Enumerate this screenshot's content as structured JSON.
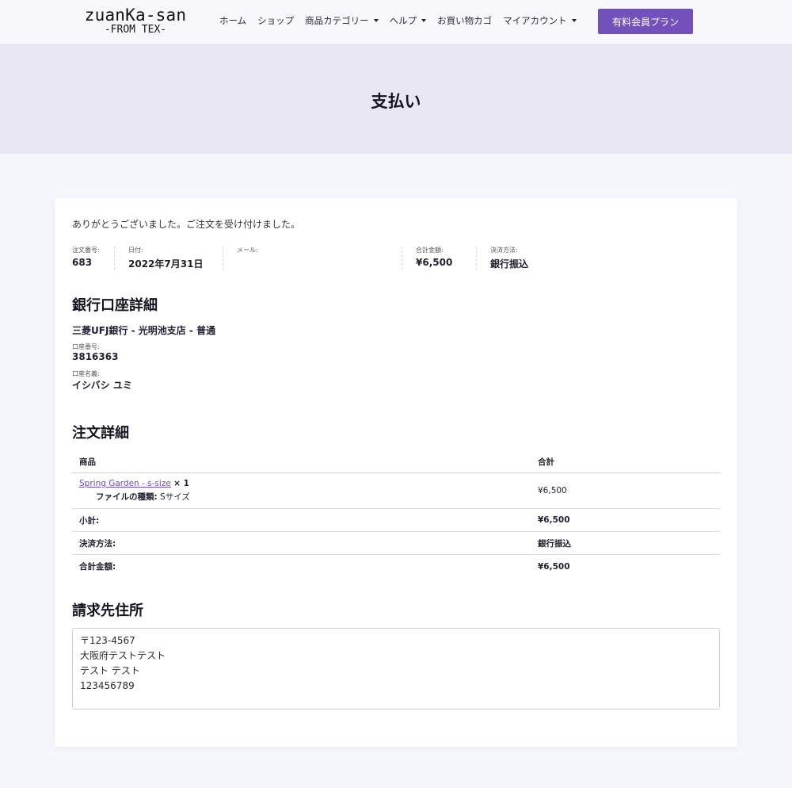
{
  "header": {
    "logo_main": "zuanKa-san",
    "logo_sub": "-FROM TEX-",
    "nav": [
      {
        "label": "ホーム",
        "dropdown": false
      },
      {
        "label": "ショップ",
        "dropdown": false
      },
      {
        "label": "商品カテゴリー",
        "dropdown": true
      },
      {
        "label": "ヘルプ",
        "dropdown": true
      },
      {
        "label": "お買い物カゴ",
        "dropdown": false
      },
      {
        "label": "マイアカウント",
        "dropdown": true
      }
    ],
    "cta_label": "有料会員プラン",
    "cta_color": "#7251bd"
  },
  "hero": {
    "title": "支払い"
  },
  "order": {
    "thanks": "ありがとうございました。ご注文を受け付けました。",
    "overview": [
      {
        "label": "注文番号:",
        "value": "683"
      },
      {
        "label": "日付:",
        "value": "2022年7月31日"
      },
      {
        "label": "メール:",
        "value": ""
      },
      {
        "label": "合計金額:",
        "value": "¥6,500"
      },
      {
        "label": "決済方法:",
        "value": "銀行振込"
      }
    ]
  },
  "bank": {
    "heading": "銀行口座詳細",
    "bank_name": "三菱UFJ銀行 - 光明池支店 - 普通",
    "account_number_label": "口座番号:",
    "account_number": "3816363",
    "account_name_label": "口座名義:",
    "account_name": "イシバシ ユミ"
  },
  "details": {
    "heading": "注文詳細",
    "col_product": "商品",
    "col_total": "合計",
    "item": {
      "name": "Spring Garden - s-size",
      "qty": "× 1",
      "meta_label": "ファイルの種類:",
      "meta_value": "Sサイズ",
      "total": "¥6,500"
    },
    "totals": [
      {
        "label": "小計:",
        "value": "¥6,500"
      },
      {
        "label": "決済方法:",
        "value": "銀行振込"
      },
      {
        "label": "合計金額:",
        "value": "¥6,500"
      }
    ]
  },
  "billing": {
    "heading": "請求先住所",
    "lines": [
      "〒123-4567",
      "大阪府テストテスト",
      "テスト テスト",
      "123456789"
    ]
  }
}
